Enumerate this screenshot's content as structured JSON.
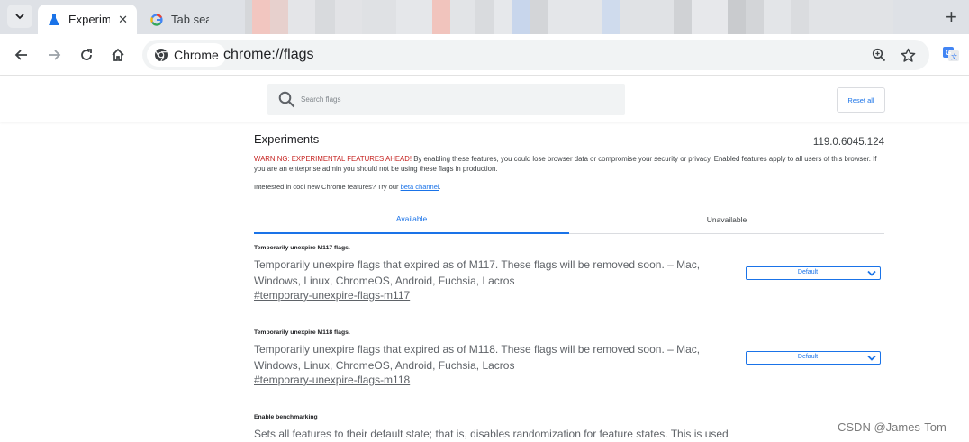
{
  "tabs": [
    {
      "title": "Experim",
      "active": true,
      "icon": "flask-icon"
    },
    {
      "title": "Tab sea",
      "active": false,
      "icon": "google-icon"
    }
  ],
  "toolbar": {
    "chip_label": "Chrome",
    "url": "chrome://flags"
  },
  "flags_header": {
    "search_placeholder": "Search flags",
    "reset_label": "Reset all"
  },
  "experiments": {
    "title": "Experiments",
    "version": "119.0.6045.124",
    "warning_red": "WARNING: EXPERIMENTAL FEATURES AHEAD!",
    "warning_rest": " By enabling these features, you could lose browser data or compromise your security or privacy. Enabled features apply to all users of this browser. If you are an enterprise admin you should not be using these flags in production.",
    "interest_text": "Interested in cool new Chrome features? Try our ",
    "interest_link": "beta channel",
    "interest_end": "."
  },
  "tabs_content": {
    "available": "Available",
    "unavailable": "Unavailable"
  },
  "flags": [
    {
      "name": "Temporarily unexpire M117 flags.",
      "description": "Temporarily unexpire flags that expired as of M117. These flags will be removed soon. – Mac, Windows, Linux, ChromeOS, Android, Fuchsia, Lacros",
      "link": "#temporary-unexpire-flags-m117",
      "value": "Default"
    },
    {
      "name": "Temporarily unexpire M118 flags.",
      "description": "Temporarily unexpire flags that expired as of M118. These flags will be removed soon. – Mac, Windows, Linux, ChromeOS, Android, Fuchsia, Lacros",
      "link": "#temporary-unexpire-flags-m118",
      "value": "Default"
    },
    {
      "name": "Enable benchmarking",
      "description": "Sets all features to their default state; that is, disables randomization for feature states. This is used"
    }
  ],
  "watermark": "CSDN @James-Tom",
  "colors": {
    "accent": "#1a73e8",
    "warning": "#c5221f",
    "tabstrip": "#dee1e6"
  }
}
